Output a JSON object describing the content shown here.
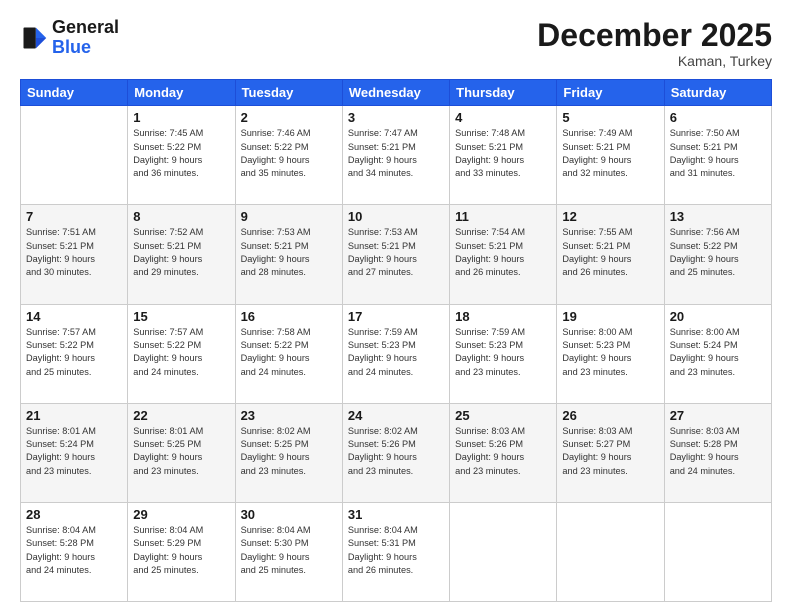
{
  "header": {
    "logo_general": "General",
    "logo_blue": "Blue",
    "month_title": "December 2025",
    "location": "Kaman, Turkey"
  },
  "days_of_week": [
    "Sunday",
    "Monday",
    "Tuesday",
    "Wednesday",
    "Thursday",
    "Friday",
    "Saturday"
  ],
  "weeks": [
    [
      {
        "day": "",
        "info": ""
      },
      {
        "day": "1",
        "info": "Sunrise: 7:45 AM\nSunset: 5:22 PM\nDaylight: 9 hours\nand 36 minutes."
      },
      {
        "day": "2",
        "info": "Sunrise: 7:46 AM\nSunset: 5:22 PM\nDaylight: 9 hours\nand 35 minutes."
      },
      {
        "day": "3",
        "info": "Sunrise: 7:47 AM\nSunset: 5:21 PM\nDaylight: 9 hours\nand 34 minutes."
      },
      {
        "day": "4",
        "info": "Sunrise: 7:48 AM\nSunset: 5:21 PM\nDaylight: 9 hours\nand 33 minutes."
      },
      {
        "day": "5",
        "info": "Sunrise: 7:49 AM\nSunset: 5:21 PM\nDaylight: 9 hours\nand 32 minutes."
      },
      {
        "day": "6",
        "info": "Sunrise: 7:50 AM\nSunset: 5:21 PM\nDaylight: 9 hours\nand 31 minutes."
      }
    ],
    [
      {
        "day": "7",
        "info": "Sunrise: 7:51 AM\nSunset: 5:21 PM\nDaylight: 9 hours\nand 30 minutes."
      },
      {
        "day": "8",
        "info": "Sunrise: 7:52 AM\nSunset: 5:21 PM\nDaylight: 9 hours\nand 29 minutes."
      },
      {
        "day": "9",
        "info": "Sunrise: 7:53 AM\nSunset: 5:21 PM\nDaylight: 9 hours\nand 28 minutes."
      },
      {
        "day": "10",
        "info": "Sunrise: 7:53 AM\nSunset: 5:21 PM\nDaylight: 9 hours\nand 27 minutes."
      },
      {
        "day": "11",
        "info": "Sunrise: 7:54 AM\nSunset: 5:21 PM\nDaylight: 9 hours\nand 26 minutes."
      },
      {
        "day": "12",
        "info": "Sunrise: 7:55 AM\nSunset: 5:21 PM\nDaylight: 9 hours\nand 26 minutes."
      },
      {
        "day": "13",
        "info": "Sunrise: 7:56 AM\nSunset: 5:22 PM\nDaylight: 9 hours\nand 25 minutes."
      }
    ],
    [
      {
        "day": "14",
        "info": "Sunrise: 7:57 AM\nSunset: 5:22 PM\nDaylight: 9 hours\nand 25 minutes."
      },
      {
        "day": "15",
        "info": "Sunrise: 7:57 AM\nSunset: 5:22 PM\nDaylight: 9 hours\nand 24 minutes."
      },
      {
        "day": "16",
        "info": "Sunrise: 7:58 AM\nSunset: 5:22 PM\nDaylight: 9 hours\nand 24 minutes."
      },
      {
        "day": "17",
        "info": "Sunrise: 7:59 AM\nSunset: 5:23 PM\nDaylight: 9 hours\nand 24 minutes."
      },
      {
        "day": "18",
        "info": "Sunrise: 7:59 AM\nSunset: 5:23 PM\nDaylight: 9 hours\nand 23 minutes."
      },
      {
        "day": "19",
        "info": "Sunrise: 8:00 AM\nSunset: 5:23 PM\nDaylight: 9 hours\nand 23 minutes."
      },
      {
        "day": "20",
        "info": "Sunrise: 8:00 AM\nSunset: 5:24 PM\nDaylight: 9 hours\nand 23 minutes."
      }
    ],
    [
      {
        "day": "21",
        "info": "Sunrise: 8:01 AM\nSunset: 5:24 PM\nDaylight: 9 hours\nand 23 minutes."
      },
      {
        "day": "22",
        "info": "Sunrise: 8:01 AM\nSunset: 5:25 PM\nDaylight: 9 hours\nand 23 minutes."
      },
      {
        "day": "23",
        "info": "Sunrise: 8:02 AM\nSunset: 5:25 PM\nDaylight: 9 hours\nand 23 minutes."
      },
      {
        "day": "24",
        "info": "Sunrise: 8:02 AM\nSunset: 5:26 PM\nDaylight: 9 hours\nand 23 minutes."
      },
      {
        "day": "25",
        "info": "Sunrise: 8:03 AM\nSunset: 5:26 PM\nDaylight: 9 hours\nand 23 minutes."
      },
      {
        "day": "26",
        "info": "Sunrise: 8:03 AM\nSunset: 5:27 PM\nDaylight: 9 hours\nand 23 minutes."
      },
      {
        "day": "27",
        "info": "Sunrise: 8:03 AM\nSunset: 5:28 PM\nDaylight: 9 hours\nand 24 minutes."
      }
    ],
    [
      {
        "day": "28",
        "info": "Sunrise: 8:04 AM\nSunset: 5:28 PM\nDaylight: 9 hours\nand 24 minutes."
      },
      {
        "day": "29",
        "info": "Sunrise: 8:04 AM\nSunset: 5:29 PM\nDaylight: 9 hours\nand 25 minutes."
      },
      {
        "day": "30",
        "info": "Sunrise: 8:04 AM\nSunset: 5:30 PM\nDaylight: 9 hours\nand 25 minutes."
      },
      {
        "day": "31",
        "info": "Sunrise: 8:04 AM\nSunset: 5:31 PM\nDaylight: 9 hours\nand 26 minutes."
      },
      {
        "day": "",
        "info": ""
      },
      {
        "day": "",
        "info": ""
      },
      {
        "day": "",
        "info": ""
      }
    ]
  ]
}
